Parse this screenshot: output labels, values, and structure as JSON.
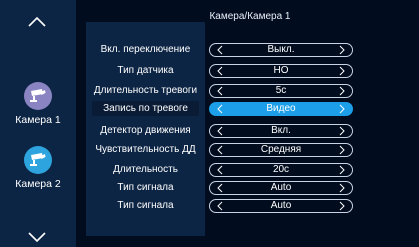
{
  "header": {
    "title": "Камера/Камера 1"
  },
  "sidebar": {
    "items": [
      {
        "label": "Камера 1",
        "icon": "cctv-camera-icon",
        "color": "#8a84c2"
      },
      {
        "label": "Камера 2",
        "icon": "cctv-camera-icon",
        "color": "#2ea4de"
      }
    ]
  },
  "settings": {
    "accent": "#1c9fe8",
    "rows": [
      {
        "label": "Вкл. переключение",
        "value": "Выкл."
      },
      {
        "label": "Тип датчика",
        "value": "НО"
      },
      {
        "label": "Длительность тревоги",
        "value": "5с"
      },
      {
        "label": "Запись по тревоге",
        "value": "Видео"
      },
      {
        "label": "Детектор движения",
        "value": "Вкл."
      },
      {
        "label": "Чувствительность ДД",
        "value": "Средняя"
      },
      {
        "label": "Длительность",
        "value": "20с"
      },
      {
        "label": "Тип сигнала",
        "value": "Auto"
      },
      {
        "label": "Тип сигнала",
        "value": "Auto"
      }
    ]
  }
}
